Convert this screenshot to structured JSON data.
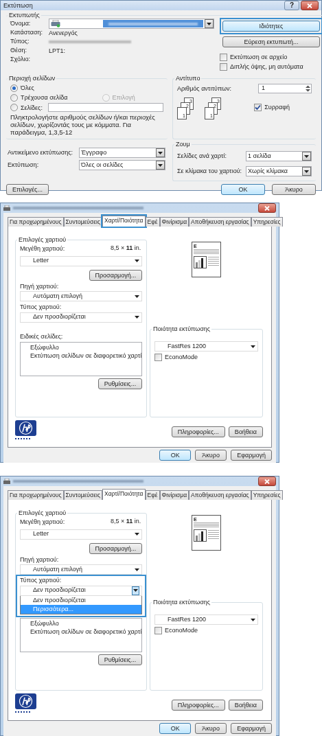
{
  "print_dialog": {
    "title": "Εκτύπωση",
    "help": "?",
    "printer": {
      "legend": "Εκτυπωτής",
      "fields": [
        {
          "label": "Όνομα:",
          "kind": "select"
        },
        {
          "label": "Κατάσταση:",
          "kind": "text",
          "value": "Ανενεργός"
        },
        {
          "label": "Τύπος:",
          "kind": "blurred"
        },
        {
          "label": "Θέση:",
          "kind": "text",
          "value": "LPT1:"
        },
        {
          "label": "Σχόλιο:",
          "kind": "text"
        }
      ],
      "buttons": [
        {
          "label": "Ιδιότητες",
          "highlighted": true
        },
        {
          "label": "Εύρεση εκτυπωτή...",
          "highlighted": false
        }
      ],
      "options": [
        {
          "label": "Εκτύπωση σε αρχείο",
          "checked": false
        },
        {
          "label": "Διπλής όψης, μη αυτόματα",
          "checked": false
        }
      ]
    },
    "page_range": {
      "legend": "Περιοχή σελίδων",
      "options": [
        {
          "label": "Όλες",
          "selected": true,
          "disabled": false
        },
        {
          "label": "Τρέχουσα σελίδα",
          "selected": false,
          "disabled": false
        },
        {
          "label": "Επιλογή",
          "selected": false,
          "disabled": true
        },
        {
          "label": "Σελίδες:",
          "selected": false,
          "disabled": false
        }
      ],
      "hint": "Πληκτρολογήστε αριθμούς σελίδων ή/και περιοχές σελίδων, χωρίζοντάς τους με κόμματα. Για παράδειγμα, 1,3,5-12"
    },
    "copies": {
      "legend": "Αντίτυπο",
      "label": "Αριθμός αντιτύπων:",
      "value": "1",
      "stacks": [
        [
          "1",
          "2",
          "3"
        ],
        [
          "1",
          "2",
          "3"
        ]
      ],
      "collate": {
        "label": "Συρραφή",
        "checked": true
      }
    },
    "print_what": [
      {
        "label": "Αντικείμενο εκτύπωσης:",
        "value": "Έγγραφο"
      },
      {
        "label": "Εκτύπωση:",
        "value": "Όλες οι σελίδες"
      }
    ],
    "zoom": {
      "legend": "Ζουμ",
      "rows": [
        {
          "label": "Σελίδες ανά χαρτί:",
          "value": "1 σελίδα"
        },
        {
          "label": "Σε κλίμακα του χαρτιού:",
          "value": "Χωρίς κλίμακα"
        }
      ]
    },
    "options_button": "Επιλογές...",
    "buttons": [
      "OK",
      "Άκυρο"
    ]
  },
  "properties_dialogs": [
    {
      "tabs": [
        {
          "label": "Για προχωρημένους",
          "selected": false,
          "highlighted": false
        },
        {
          "label": "Συντομεύσεις",
          "selected": false,
          "highlighted": false
        },
        {
          "label": "Χαρτί/Ποιότητα",
          "selected": true,
          "highlighted": true
        },
        {
          "label": "Εφέ",
          "selected": false,
          "highlighted": false
        },
        {
          "label": "Φινίρισμα",
          "selected": false,
          "highlighted": false
        },
        {
          "label": "Αποθήκευση εργασίας",
          "selected": false,
          "highlighted": false
        },
        {
          "label": "Υπηρεσίες",
          "selected": false,
          "highlighted": false
        }
      ],
      "paper_options": {
        "legend": "Επιλογές χαρτιού",
        "size_label": "Μεγέθη χαρτιού:",
        "size_value": "8,5 × **11** in.",
        "size": "Letter",
        "custom_button": "Προσαρμογή...",
        "source_label": "Πηγή χαρτιού:",
        "source": "Αυτόματη επιλογή",
        "type_label": "Τύπος χαρτιού:",
        "type": "Δεν προσδιορίζεται",
        "type_highlighted": false
      },
      "special_pages": {
        "label": "Ειδικές σελίδες:",
        "items": [
          "Εξώφυλλο",
          "Εκτύπωση σελίδων σε διαφορετικό χαρτί"
        ],
        "button": "Ρυθμίσεις..."
      },
      "preview_initial": "E",
      "quality": {
        "legend": "Ποιότητα εκτύπωσης",
        "value": "FastRes 1200",
        "econo": {
          "label": "EconoMode",
          "checked": false
        }
      },
      "info_buttons": [
        "Πληροφορίες...",
        "Βοήθεια"
      ],
      "buttons": [
        "OK",
        "Άκυρο",
        "Εφαρμογή"
      ]
    },
    {
      "tabs": [
        {
          "label": "Για προχωρημένους",
          "selected": false,
          "highlighted": false
        },
        {
          "label": "Συντομεύσεις",
          "selected": false,
          "highlighted": false
        },
        {
          "label": "Χαρτί/Ποιότητα",
          "selected": true,
          "highlighted": false
        },
        {
          "label": "Εφέ",
          "selected": false,
          "highlighted": false
        },
        {
          "label": "Φινίρισμα",
          "selected": false,
          "highlighted": false
        },
        {
          "label": "Αποθήκευση εργασίας",
          "selected": false,
          "highlighted": false
        },
        {
          "label": "Υπηρεσίες",
          "selected": false,
          "highlighted": false
        }
      ],
      "paper_options": {
        "legend": "Επιλογές χαρτιού",
        "size_label": "Μεγέθη χαρτιού:",
        "size_value": "8,5 × **11** in.",
        "size": "Letter",
        "custom_button": "Προσαρμογή...",
        "source_label": "Πηγή χαρτιού:",
        "source": "Αυτόματη επιλογή",
        "type_label": "Τύπος χαρτιού:",
        "type": "Δεν προσδιορίζεται",
        "type_highlighted": true,
        "type_options": [
          {
            "label": "Δεν προσδιορίζεται",
            "selected": false
          },
          {
            "label": "Περισσότερα...",
            "selected": true
          }
        ]
      },
      "special_pages": {
        "items": [
          "Εξώφυλλο",
          "Εκτύπωση σελίδων σε διαφορετικό χαρτί"
        ],
        "button": "Ρυθμίσεις..."
      },
      "preview_initial": "E",
      "quality": {
        "legend": "Ποιότητα εκτύπωσης",
        "value": "FastRes 1200",
        "econo": {
          "label": "EconoMode",
          "checked": false
        }
      },
      "info_buttons": [
        "Πληροφορίες...",
        "Βοήθεια"
      ],
      "buttons": [
        "OK",
        "Άκυρο",
        "Εφαρμογή"
      ]
    }
  ]
}
